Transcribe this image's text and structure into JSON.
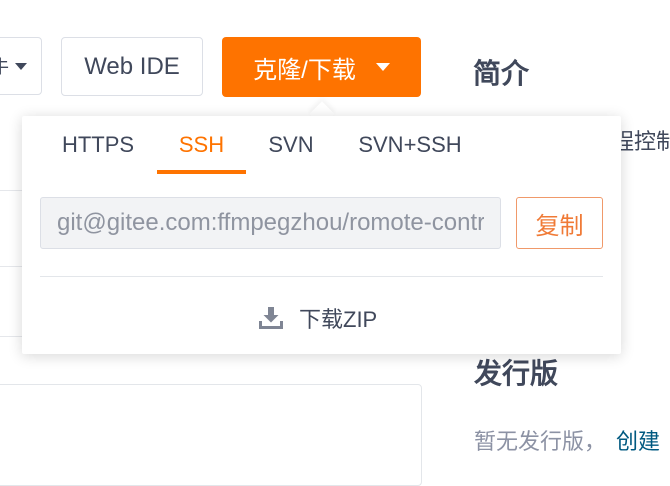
{
  "toolbar": {
    "partial_button_text": "牛",
    "web_ide_label": "Web IDE",
    "clone_label": "克隆/下载",
    "accent_color": "#fe7300"
  },
  "sidebar": {
    "intro_title": "简介",
    "intro_text_partial": "程控制",
    "releases_title": "发行版",
    "releases_empty": "暂无发行版，",
    "releases_create_link": "创建"
  },
  "clone_dropdown": {
    "tabs": [
      {
        "label": "HTTPS",
        "active": false
      },
      {
        "label": "SSH",
        "active": true
      },
      {
        "label": "SVN",
        "active": false
      },
      {
        "label": "SVN+SSH",
        "active": false
      }
    ],
    "url_value": "git@gitee.com:ffmpegzhou/romote-control",
    "copy_label": "复制",
    "download_zip_label": "下载ZIP",
    "download_icon": "download-icon"
  }
}
